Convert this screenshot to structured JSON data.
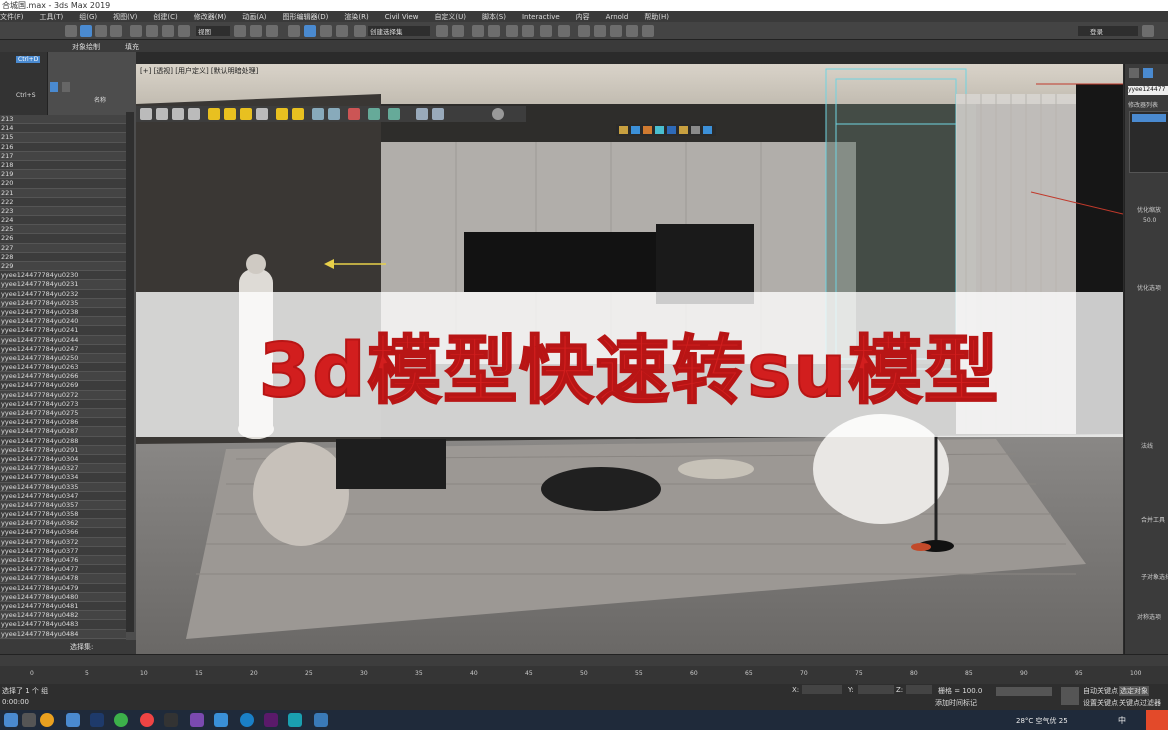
{
  "window": {
    "title": "合城国.max - 3ds Max 2019"
  },
  "menu": [
    "文件(F)",
    "工具(T)",
    "组(G)",
    "视图(V)",
    "创建(C)",
    "修改器(M)",
    "动画(A)",
    "图形编辑器(D)",
    "渲染(R)",
    "Civil View",
    "自定义(U)",
    "脚本(S)",
    "Interactive",
    "内容",
    "Arnold",
    "帮助(H)"
  ],
  "toolbar": {
    "view_dropdown": "视图",
    "selection_set": "创建选择集",
    "login": "登录"
  },
  "subbar": {
    "tab1": "对象绘制",
    "tab2": "填充"
  },
  "left": {
    "shortcut1": "Ctrl+D",
    "shortcut2": "Ctrl+S",
    "scene_header": "名称"
  },
  "scene_rows": [
    "213",
    "214",
    "215",
    "216",
    "217",
    "218",
    "219",
    "220",
    "221",
    "222",
    "223",
    "224",
    "225",
    "226",
    "227",
    "228",
    "229",
    "yyee124477784yu0230",
    "yyee124477784yu0231",
    "yyee124477784yu0232",
    "yyee124477784yu0235",
    "yyee124477784yu0238",
    "yyee124477784yu0240",
    "yyee124477784yu0241",
    "yyee124477784yu0244",
    "yyee124477784yu0247",
    "yyee124477784yu0250",
    "yyee124477784yu0263",
    "yyee124477784yu0266",
    "yyee124477784yu0269",
    "yyee124477784yu0272",
    "yyee124477784yu0273",
    "yyee124477784yu0275",
    "yyee124477784yu0286",
    "yyee124477784yu0287",
    "yyee124477784yu0288",
    "yyee124477784yu0291",
    "yyee124477784yu0304",
    "yyee124477784yu0327",
    "yyee124477784yu0334",
    "yyee124477784yu0335",
    "yyee124477784yu0347",
    "yyee124477784yu0357",
    "yyee124477784yu0358",
    "yyee124477784yu0362",
    "yyee124477784yu0366",
    "yyee124477784yu0372",
    "yyee124477784yu0377",
    "yyee124477784yu0476",
    "yyee124477784yu0477",
    "yyee124477784yu0478",
    "yyee124477784yu0479",
    "yyee124477784yu0480",
    "yyee124477784yu0481",
    "yyee124477784yu0482",
    "yyee124477784yu0483",
    "yyee124477784yu0484",
    "yyee124477784yu0485",
    "yyee124477784yu0486",
    "yyee124477784yu0487"
  ],
  "scene_footer": "选择集:",
  "viewport": {
    "label": "[+] [透视] [用户定义] [默认明暗处理]"
  },
  "banner": {
    "text": "3d模型快速转su模型"
  },
  "right": {
    "modifier_list": "修改器列表",
    "object_name": "yyee124477",
    "sec1": "优化缩放",
    "val1": "50.0",
    "sec2": "优化选项",
    "sec3": "法线",
    "sec4": "合并工具",
    "sec5": "子对象选择",
    "sec6": "对称选项"
  },
  "timeline": {
    "ticks": [
      "0",
      "5",
      "10",
      "15",
      "20",
      "25",
      "30",
      "35",
      "40",
      "45",
      "50",
      "55",
      "60",
      "65",
      "70",
      "75",
      "80",
      "85",
      "90",
      "95",
      "100"
    ]
  },
  "status": {
    "selected": "选择了 1 个 组",
    "time": "0:00:00",
    "x_label": "X:",
    "y_label": "Y:",
    "z_label": "Z:",
    "grid": "栅格 = 100.0",
    "auto_key": "自动关键点",
    "set_key": "设置关键点",
    "sel_obj": "选定对象",
    "add_tag": "添加时间标记",
    "key_filter": "关键点过滤器"
  },
  "taskbar": {
    "weather": "28°C 空气优 25",
    "lang": "中"
  }
}
